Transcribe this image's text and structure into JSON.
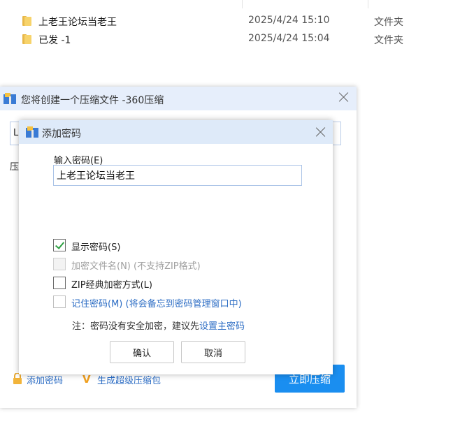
{
  "files": [
    {
      "name": "上老王论坛当老王",
      "date": "2025/4/24 15:10",
      "type": "文件夹"
    },
    {
      "name": "已发 -1",
      "date": "2025/4/24 15:04",
      "type": "文件夹"
    }
  ],
  "outer_dialog": {
    "title": "您将创建一个压缩文件 -360压缩",
    "path_prefix": "L",
    "label_prefix": "压",
    "add_password_link": "添加密码",
    "super_pack_link": "生成超级压缩包",
    "compress_button": "立即压缩"
  },
  "password_dialog": {
    "title": "添加密码",
    "input_label": "输入密码(E)",
    "password_value": "上老王论坛当老王",
    "show_password": {
      "label": "显示密码(S)",
      "checked": true
    },
    "encrypt_filenames": {
      "label": "加密文件名(N) (不支持ZIP格式)",
      "checked": false,
      "disabled": true
    },
    "zip_classic": {
      "label": "ZIP经典加密方式(L)",
      "checked": false
    },
    "remember_password": {
      "label": "记住密码(M) (将会备忘到密码管理窗口中)",
      "checked": false
    },
    "note_text": "注：密码没有安全加密，建议先",
    "note_link": "设置主密码",
    "ok_button": "确认",
    "cancel_button": "取消"
  },
  "colors": {
    "accent": "#1a8ef0",
    "link": "#2b6cc4",
    "check": "#2ea043",
    "title_bar": "#deeaf9"
  }
}
